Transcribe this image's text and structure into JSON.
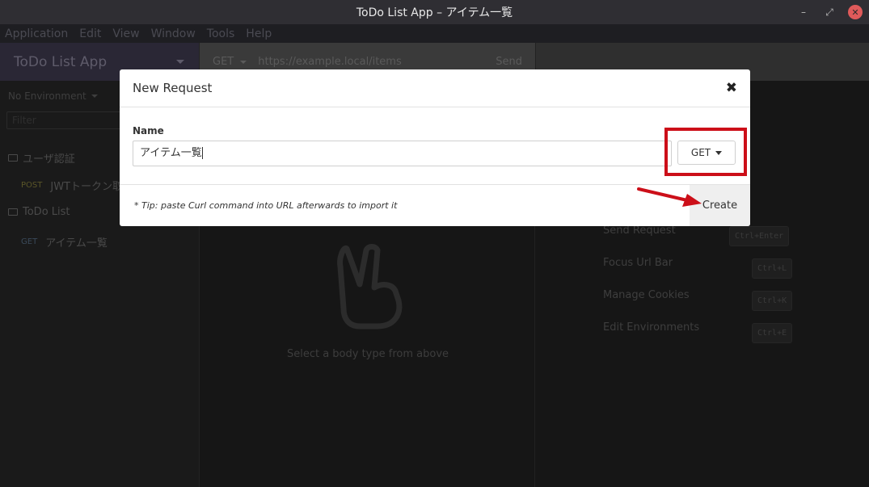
{
  "window": {
    "title": "ToDo List App – アイテム一覧",
    "minimize_glyph": "–",
    "restore_glyph": "⤢",
    "close_glyph": "✕"
  },
  "menu": [
    "Application",
    "Edit",
    "View",
    "Window",
    "Tools",
    "Help"
  ],
  "sidebar": {
    "workspace": "ToDo List App",
    "environment": "No Environment",
    "filter_placeholder": "Filter",
    "folders": [
      {
        "name": "ユーザ認証",
        "requests": [
          {
            "method": "POST",
            "name": "JWTトークン取"
          }
        ]
      },
      {
        "name": "ToDo List",
        "requests": [
          {
            "method": "GET",
            "name": "アイテム一覧"
          }
        ]
      }
    ]
  },
  "urlbar": {
    "method": "GET",
    "url": "https://example.local/items",
    "send_label": "Send"
  },
  "body": {
    "hint": "Select a body type from above"
  },
  "shortcuts": [
    {
      "label": "Send Request",
      "keys": "Ctrl+Enter"
    },
    {
      "label": "Focus Url Bar",
      "keys": "Ctrl+L"
    },
    {
      "label": "Manage Cookies",
      "keys": "Ctrl+K"
    },
    {
      "label": "Edit Environments",
      "keys": "Ctrl+E"
    }
  ],
  "modal": {
    "title": "New Request",
    "close_glyph": "✖",
    "name_label": "Name",
    "name_value": "アイテム一覧",
    "method": "GET",
    "tip": "* Tip: paste Curl command into URL afterwards to import it",
    "create_label": "Create"
  },
  "colors": {
    "highlight": "#cc0f19",
    "sidebar_header": "#2a2735",
    "close_button": "#e05a5a"
  }
}
